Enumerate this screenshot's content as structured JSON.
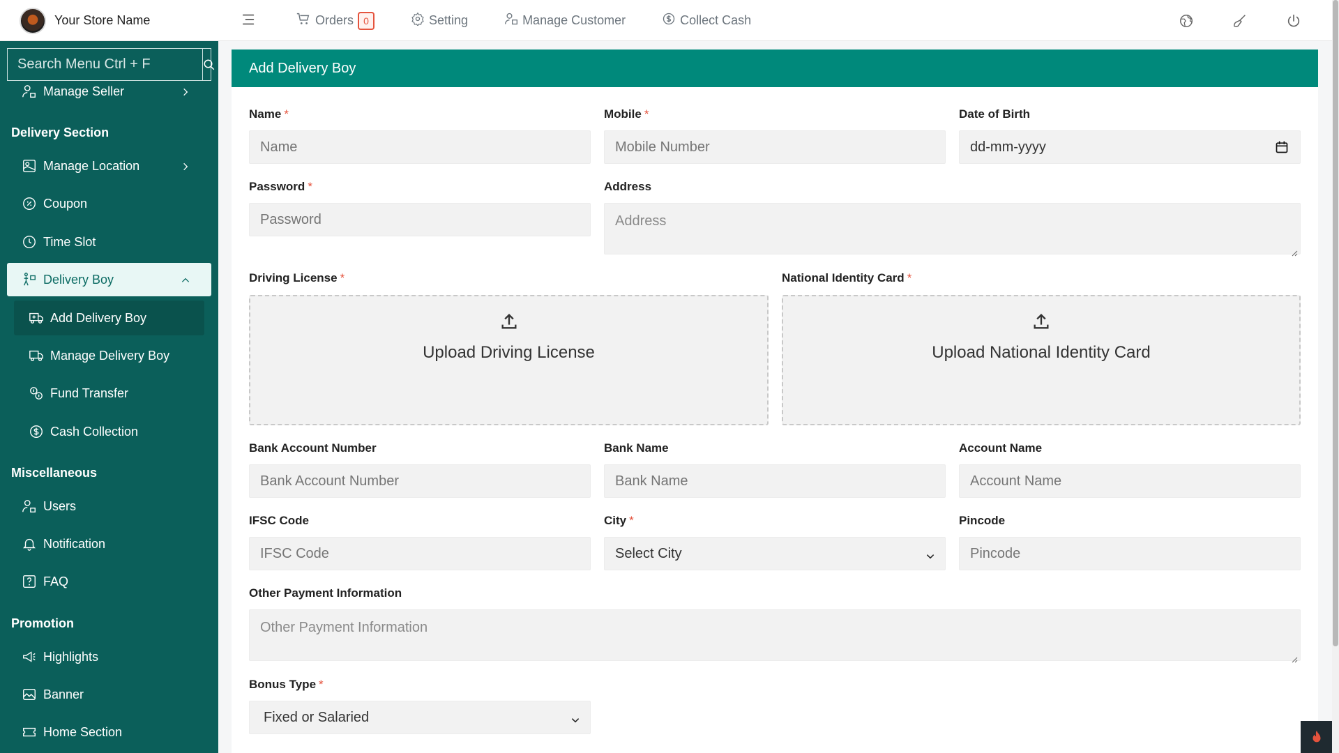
{
  "header": {
    "store_name": "Your Store Name",
    "nav": {
      "orders_label": "Orders",
      "orders_count": "0",
      "setting_label": "Setting",
      "manage_customer_label": "Manage Customer",
      "collect_cash_label": "Collect Cash"
    },
    "icons": [
      "hamburger-icon",
      "globe-icon",
      "brush-icon",
      "power-icon"
    ]
  },
  "sidebar": {
    "search_placeholder": "Search Menu Ctrl + F",
    "manage_seller": "Manage Seller",
    "delivery_section": "Delivery Section",
    "manage_location": "Manage Location",
    "coupon": "Coupon",
    "time_slot": "Time Slot",
    "delivery_boy": "Delivery Boy",
    "add_delivery_boy": "Add Delivery Boy",
    "manage_delivery_boy": "Manage Delivery Boy",
    "fund_transfer": "Fund Transfer",
    "cash_collection": "Cash Collection",
    "miscellaneous": "Miscellaneous",
    "users": "Users",
    "notification": "Notification",
    "faq": "FAQ",
    "promotion": "Promotion",
    "highlights": "Highlights",
    "banner": "Banner",
    "home_section": "Home Section"
  },
  "form": {
    "title": "Add Delivery Boy",
    "name": {
      "label": "Name",
      "placeholder": "Name"
    },
    "mobile": {
      "label": "Mobile",
      "placeholder": "Mobile Number"
    },
    "dob": {
      "label": "Date of Birth",
      "value": "dd-mm-yyyy"
    },
    "password": {
      "label": "Password",
      "placeholder": "Password"
    },
    "address": {
      "label": "Address",
      "placeholder": "Address"
    },
    "driving_license": {
      "label": "Driving License",
      "upload_text": "Upload Driving License"
    },
    "national_id": {
      "label": "National Identity Card",
      "upload_text": "Upload National Identity Card"
    },
    "bank_account_number": {
      "label": "Bank Account Number",
      "placeholder": "Bank Account Number"
    },
    "bank_name": {
      "label": "Bank Name",
      "placeholder": "Bank Name"
    },
    "account_name": {
      "label": "Account Name",
      "placeholder": "Account Name"
    },
    "ifsc": {
      "label": "IFSC Code",
      "placeholder": "IFSC Code"
    },
    "city": {
      "label": "City",
      "value": "Select City"
    },
    "pincode": {
      "label": "Pincode",
      "placeholder": "Pincode"
    },
    "other_payment": {
      "label": "Other Payment Information",
      "placeholder": "Other Payment Information"
    },
    "bonus_type": {
      "label": "Bonus Type",
      "value": "Fixed or Salaried"
    },
    "required_mark": "*"
  },
  "colors": {
    "sidebar_bg": "#0b5f5a",
    "header_accent": "#00897b",
    "required": "#e5533d"
  }
}
